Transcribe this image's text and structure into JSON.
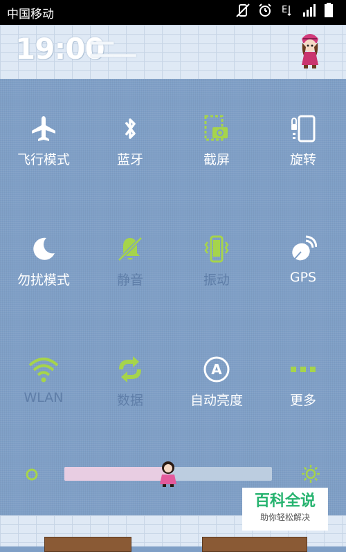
{
  "status_bar": {
    "carrier": "中国移动",
    "icons": [
      "mute-vibrate-icon",
      "alarm-icon",
      "data-e-icon",
      "signal-icon",
      "battery-icon"
    ]
  },
  "header": {
    "time": "19:00"
  },
  "toggles": [
    {
      "label": "飞行模式",
      "icon": "airplane-icon",
      "active": true
    },
    {
      "label": "蓝牙",
      "icon": "bluetooth-icon",
      "active": true
    },
    {
      "label": "截屏",
      "icon": "screenshot-icon",
      "active": true
    },
    {
      "label": "旋转",
      "icon": "rotate-icon",
      "active": true
    },
    {
      "label": "勿扰模式",
      "icon": "moon-icon",
      "active": true
    },
    {
      "label": "静音",
      "icon": "bell-mute-icon",
      "active": false
    },
    {
      "label": "振动",
      "icon": "vibrate-icon",
      "active": false
    },
    {
      "label": "GPS",
      "icon": "gps-icon",
      "active": true
    },
    {
      "label": "WLAN",
      "icon": "wifi-icon",
      "active": false
    },
    {
      "label": "数据",
      "icon": "data-sync-icon",
      "active": false
    },
    {
      "label": "自动亮度",
      "icon": "auto-brightness-icon",
      "active": true
    },
    {
      "label": "更多",
      "icon": "more-icon",
      "active": true
    }
  ],
  "brightness": {
    "level": 0.5
  },
  "watermark": {
    "title": "百科全说",
    "subtitle": "助你轻松解决"
  },
  "colors": {
    "panel": "#7f9fc6",
    "accent_green": "#a6d44b",
    "inactive_text": "#5f7ea8"
  }
}
